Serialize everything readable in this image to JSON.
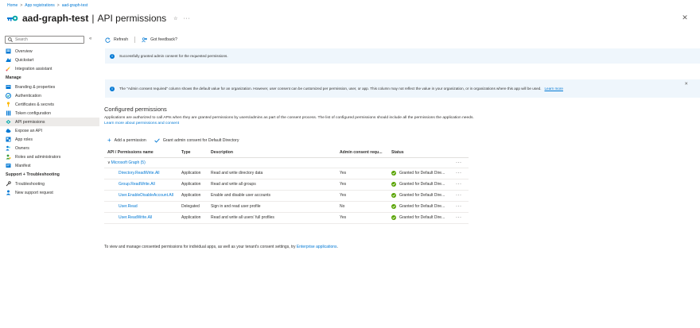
{
  "breadcrumb": {
    "home": "Home",
    "app_registrations": "App registrations",
    "current": "aad-graph-test",
    "separator": ">"
  },
  "header": {
    "app_name": "aad-graph-test",
    "separator": "|",
    "page_title": "API permissions",
    "pin_glyph": "☆",
    "more_glyph": "···",
    "close_glyph": "✕"
  },
  "sidebar": {
    "search_placeholder": "Search",
    "collapse_glyph": "«",
    "items_top": [
      {
        "label": "Overview",
        "icon": "overview-icon",
        "color": "#0078d4"
      },
      {
        "label": "Quickstart",
        "icon": "quickstart-icon",
        "color": "#0078d4"
      },
      {
        "label": "Integration assistant",
        "icon": "rocket-icon",
        "color": "#ffb900"
      }
    ],
    "section_manage": "Manage",
    "items_manage": [
      {
        "label": "Branding & properties",
        "icon": "branding-icon",
        "color": "#0078d4"
      },
      {
        "label": "Authentication",
        "icon": "authentication-icon",
        "color": "#0078d4"
      },
      {
        "label": "Certificates & secrets",
        "icon": "key-icon",
        "color": "#ffb900"
      },
      {
        "label": "Token configuration",
        "icon": "token-icon",
        "color": "#0078d4"
      },
      {
        "label": "API permissions",
        "icon": "api-permissions-icon",
        "color": "#00a4a6",
        "active": true
      },
      {
        "label": "Expose an API",
        "icon": "cloud-icon",
        "color": "#0078d4"
      },
      {
        "label": "App roles",
        "icon": "app-roles-icon",
        "color": "#0078d4"
      },
      {
        "label": "Owners",
        "icon": "owners-icon",
        "color": "#0078d4"
      },
      {
        "label": "Roles and administrators",
        "icon": "roles-icon",
        "color": "#3a9b3a"
      },
      {
        "label": "Manifest",
        "icon": "manifest-icon",
        "color": "#0078d4"
      }
    ],
    "section_support": "Support + Troubleshooting",
    "items_support": [
      {
        "label": "Troubleshooting",
        "icon": "wrench-icon",
        "color": "#323130"
      },
      {
        "label": "New support request",
        "icon": "support-icon",
        "color": "#0078d4"
      }
    ]
  },
  "toolbar": {
    "refresh": "Refresh",
    "feedback": "Got feedback?"
  },
  "banners": {
    "success": "Successfully granted admin consent for the requested permissions.",
    "info": "The \"Admin consent required\" column shows the default value for an organization. However, user consent can be customized per permission, user, or app. This column may not reflect the value in your organization, or in organizations where this app will be used.",
    "info_link": "Learn more",
    "close_glyph": "✕"
  },
  "configured": {
    "title": "Configured permissions",
    "desc": "Applications are authorized to call APIs when they are granted permissions by users/admins as part of the consent process. The list of configured permissions should include all the permissions the application needs.",
    "desc_link": "Learn more about permissions and consent",
    "add_permission": "Add a permission",
    "grant_consent": "Grant admin consent for Default Directory"
  },
  "table": {
    "headers": [
      "API / Permissions name",
      "Type",
      "Description",
      "Admin consent requ...",
      "Status"
    ],
    "group": {
      "chevron": "∨",
      "label": "Microsoft Graph (5)",
      "more": "···"
    },
    "rows": [
      {
        "name": "Directory.ReadWrite.All",
        "type": "Application",
        "description": "Read and write directory data",
        "consent": "Yes",
        "status": "Granted for Default Dire...",
        "more": "···"
      },
      {
        "name": "Group.ReadWrite.All",
        "type": "Application",
        "description": "Read and write all groups",
        "consent": "Yes",
        "status": "Granted for Default Dire...",
        "more": "···"
      },
      {
        "name": "User.EnableDisableAccount.All",
        "type": "Application",
        "description": "Enable and disable user accounts",
        "consent": "Yes",
        "status": "Granted for Default Dire...",
        "more": "···"
      },
      {
        "name": "User.Read",
        "type": "Delegated",
        "description": "Sign in and read user profile",
        "consent": "No",
        "status": "Granted for Default Dire...",
        "more": "···"
      },
      {
        "name": "User.ReadWrite.All",
        "type": "Application",
        "description": "Read and write all users' full profiles",
        "consent": "Yes",
        "status": "Granted for Default Dire...",
        "more": "···"
      }
    ]
  },
  "footer": {
    "text": "To view and manage consented permissions for individual apps, as well as your tenant's consent settings, try",
    "link": "Enterprise applications",
    "end": "."
  },
  "colors": {
    "accent": "#0078d4",
    "success": "#57a300",
    "banner_bg": "#eff6fc"
  }
}
